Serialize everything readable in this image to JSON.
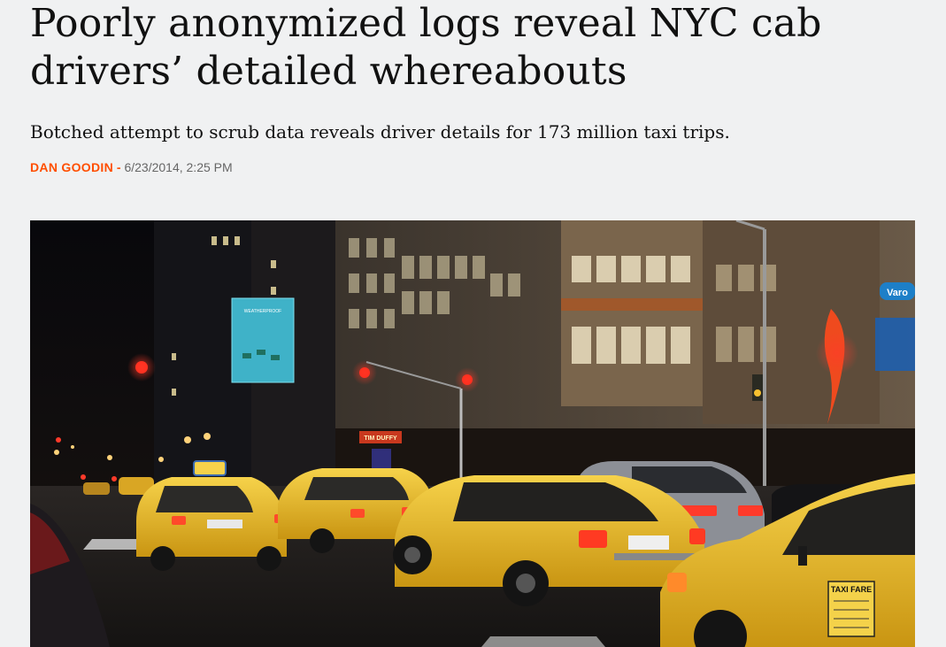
{
  "article": {
    "headline": "Poorly anonymized logs reveal NYC cab drivers’ detailed whereabouts",
    "dek": "Botched attempt to scrub data reveals driver details for 173 million taxi trips.",
    "author": "DAN GOODIN",
    "separator": " - ",
    "timestamp": "6/23/2014, 2:25 PM"
  },
  "hero": {
    "billboard_text": "WEATHERPROOF",
    "storefront_sign": "TIM DUFFY",
    "taxi_sign": "TAXI FARE",
    "street_sign": "Varo"
  },
  "colors": {
    "accent": "#ff4e00",
    "taxi_yellow": "#f3c21a",
    "background": "#f0f1f2"
  }
}
